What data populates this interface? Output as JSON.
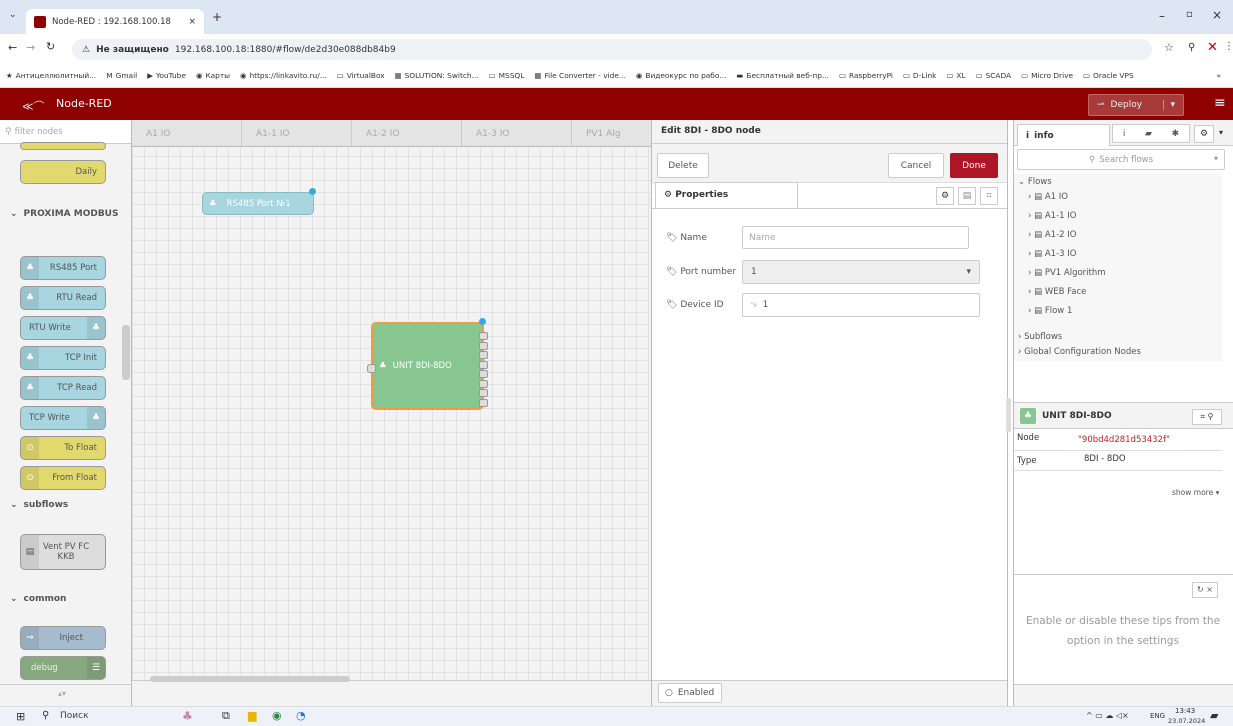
{
  "browser": {
    "tab_title": "Node-RED : 192.168.100.18",
    "url_warning": "Не защищено",
    "url": "192.168.100.18:1880/#flow/de2d30e088db84b9",
    "bookmarks": [
      "Антицеллюлитный...",
      "Gmail",
      "YouTube",
      "Карты",
      "https://linkavito.ru/...",
      "VirtualBox",
      "SOLUTION: Switch...",
      "MSSQL",
      "File Converter - vide...",
      "Видеокурс по рабо...",
      "Бесплатный веб-пр...",
      "RaspberryPi",
      "D-Link",
      "XL",
      "SCADA",
      "Micro Drive",
      "Oracle VPS"
    ]
  },
  "app": {
    "title": "Node-RED",
    "deploy": "Deploy"
  },
  "palette": {
    "filter_placeholder": "filter nodes",
    "daily": "Daily",
    "cat_modbus": "PROXIMA MODBUS",
    "nodes": [
      "RS485 Port",
      "RTU Read",
      "RTU Write",
      "TCP Init",
      "TCP Read",
      "TCP Write",
      "To Float",
      "From Float"
    ],
    "cat_subflows": "subflows",
    "subflow_node": "Vent PV FC KKB",
    "cat_common": "common",
    "inject": "Inject",
    "debug": "debug"
  },
  "workspace": {
    "tabs": [
      "A1 IO",
      "A1-1 IO",
      "A1-2 IO",
      "A1-3 IO",
      "PV1 Alg"
    ],
    "node_rs485": "RS485 Port №1",
    "node_unit": "UNIT 8DI-8DO"
  },
  "editor": {
    "title": "Edit 8DI - 8DO node",
    "delete": "Delete",
    "cancel": "Cancel",
    "done": "Done",
    "properties_tab": "Properties",
    "name_label": "Name",
    "name_placeholder": "Name",
    "port_label": "Port number",
    "port_value": "1",
    "device_label": "Device ID",
    "device_value": "1",
    "enabled": "Enabled"
  },
  "sidebar": {
    "tab_info": "info",
    "search_placeholder": "Search flows",
    "flows_label": "Flows",
    "flows": [
      "A1 IO",
      "A1-1 IO",
      "A1-2 IO",
      "A1-3 IO",
      "PV1 Algorithm",
      "WEB Face",
      "Flow 1"
    ],
    "subflows": "Subflows",
    "global_config": "Global Configuration Nodes",
    "selected_node": "UNIT 8DI-8DO",
    "node_key": "Node",
    "node_id": "\"90bd4d281d53432f\"",
    "type_key": "Type",
    "type_value": "8DI - 8DO",
    "show_more": "show more ▾",
    "tip": "Enable or disable these tips from the option in the settings"
  },
  "taskbar": {
    "search": "Поиск",
    "lang": "ENG",
    "time": "13:43",
    "date": "23.07.2024"
  },
  "colors": {
    "header": "#8f0000",
    "done": "#ad1625",
    "unit_node": "#87c591",
    "modbus_node": "#a7d5e0",
    "function_node": "#e2d96e",
    "port_dot": "#38a9e0"
  }
}
